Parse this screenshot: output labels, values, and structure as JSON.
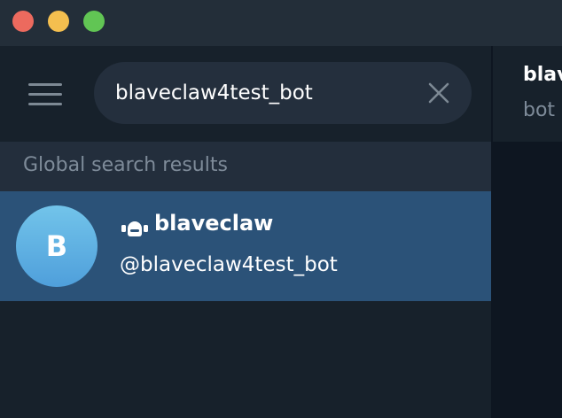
{
  "window": {
    "controls": [
      "close",
      "minimize",
      "maximize"
    ]
  },
  "search": {
    "value": "blaveclaw4test_bot",
    "icons": {
      "menu": "hamburger-menu-icon",
      "clear": "close-x-icon"
    }
  },
  "results": {
    "section_title": "Global search results",
    "items": [
      {
        "avatar_letter": "B",
        "name": "blaveclaw",
        "username": "@blaveclaw4test_bot",
        "icon": "bot-icon"
      }
    ]
  },
  "chat_header": {
    "title": "blav",
    "subtitle": "bot"
  },
  "colors": {
    "sidebar_bg": "#17212b",
    "search_bg": "#242f3d",
    "selected_row": "#2b5278",
    "avatar_top": "#72c4ea",
    "avatar_bottom": "#4f9fdb",
    "muted_text": "#7e8b99"
  }
}
